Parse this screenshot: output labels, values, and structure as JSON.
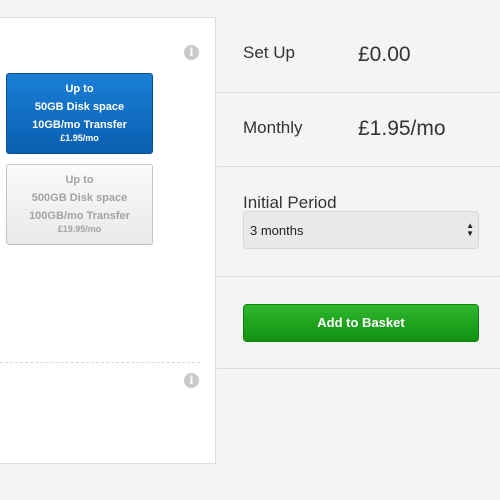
{
  "plans": [
    {
      "line1": "Up to",
      "line2": "50GB Disk space",
      "line3": "10GB/mo Transfer",
      "price": "£1.95/mo",
      "selected": true
    },
    {
      "line1": "Up to",
      "line2": "500GB Disk space",
      "line3": "100GB/mo Transfer",
      "price": "£19.95/mo",
      "selected": false
    }
  ],
  "info_icon_glyph": "i",
  "summary": {
    "setup_label": "Set Up",
    "setup_value": "£0.00",
    "monthly_label": "Monthly",
    "monthly_value": "£1.95/mo",
    "period_label": "Initial Period",
    "period_selected": "3 months",
    "basket_label": "Add to Basket"
  },
  "colors": {
    "selected_plan": "#0a6fc6",
    "add_button": "#1ea31e"
  },
  "icons": [
    "info-icon",
    "select-arrows-icon"
  ]
}
